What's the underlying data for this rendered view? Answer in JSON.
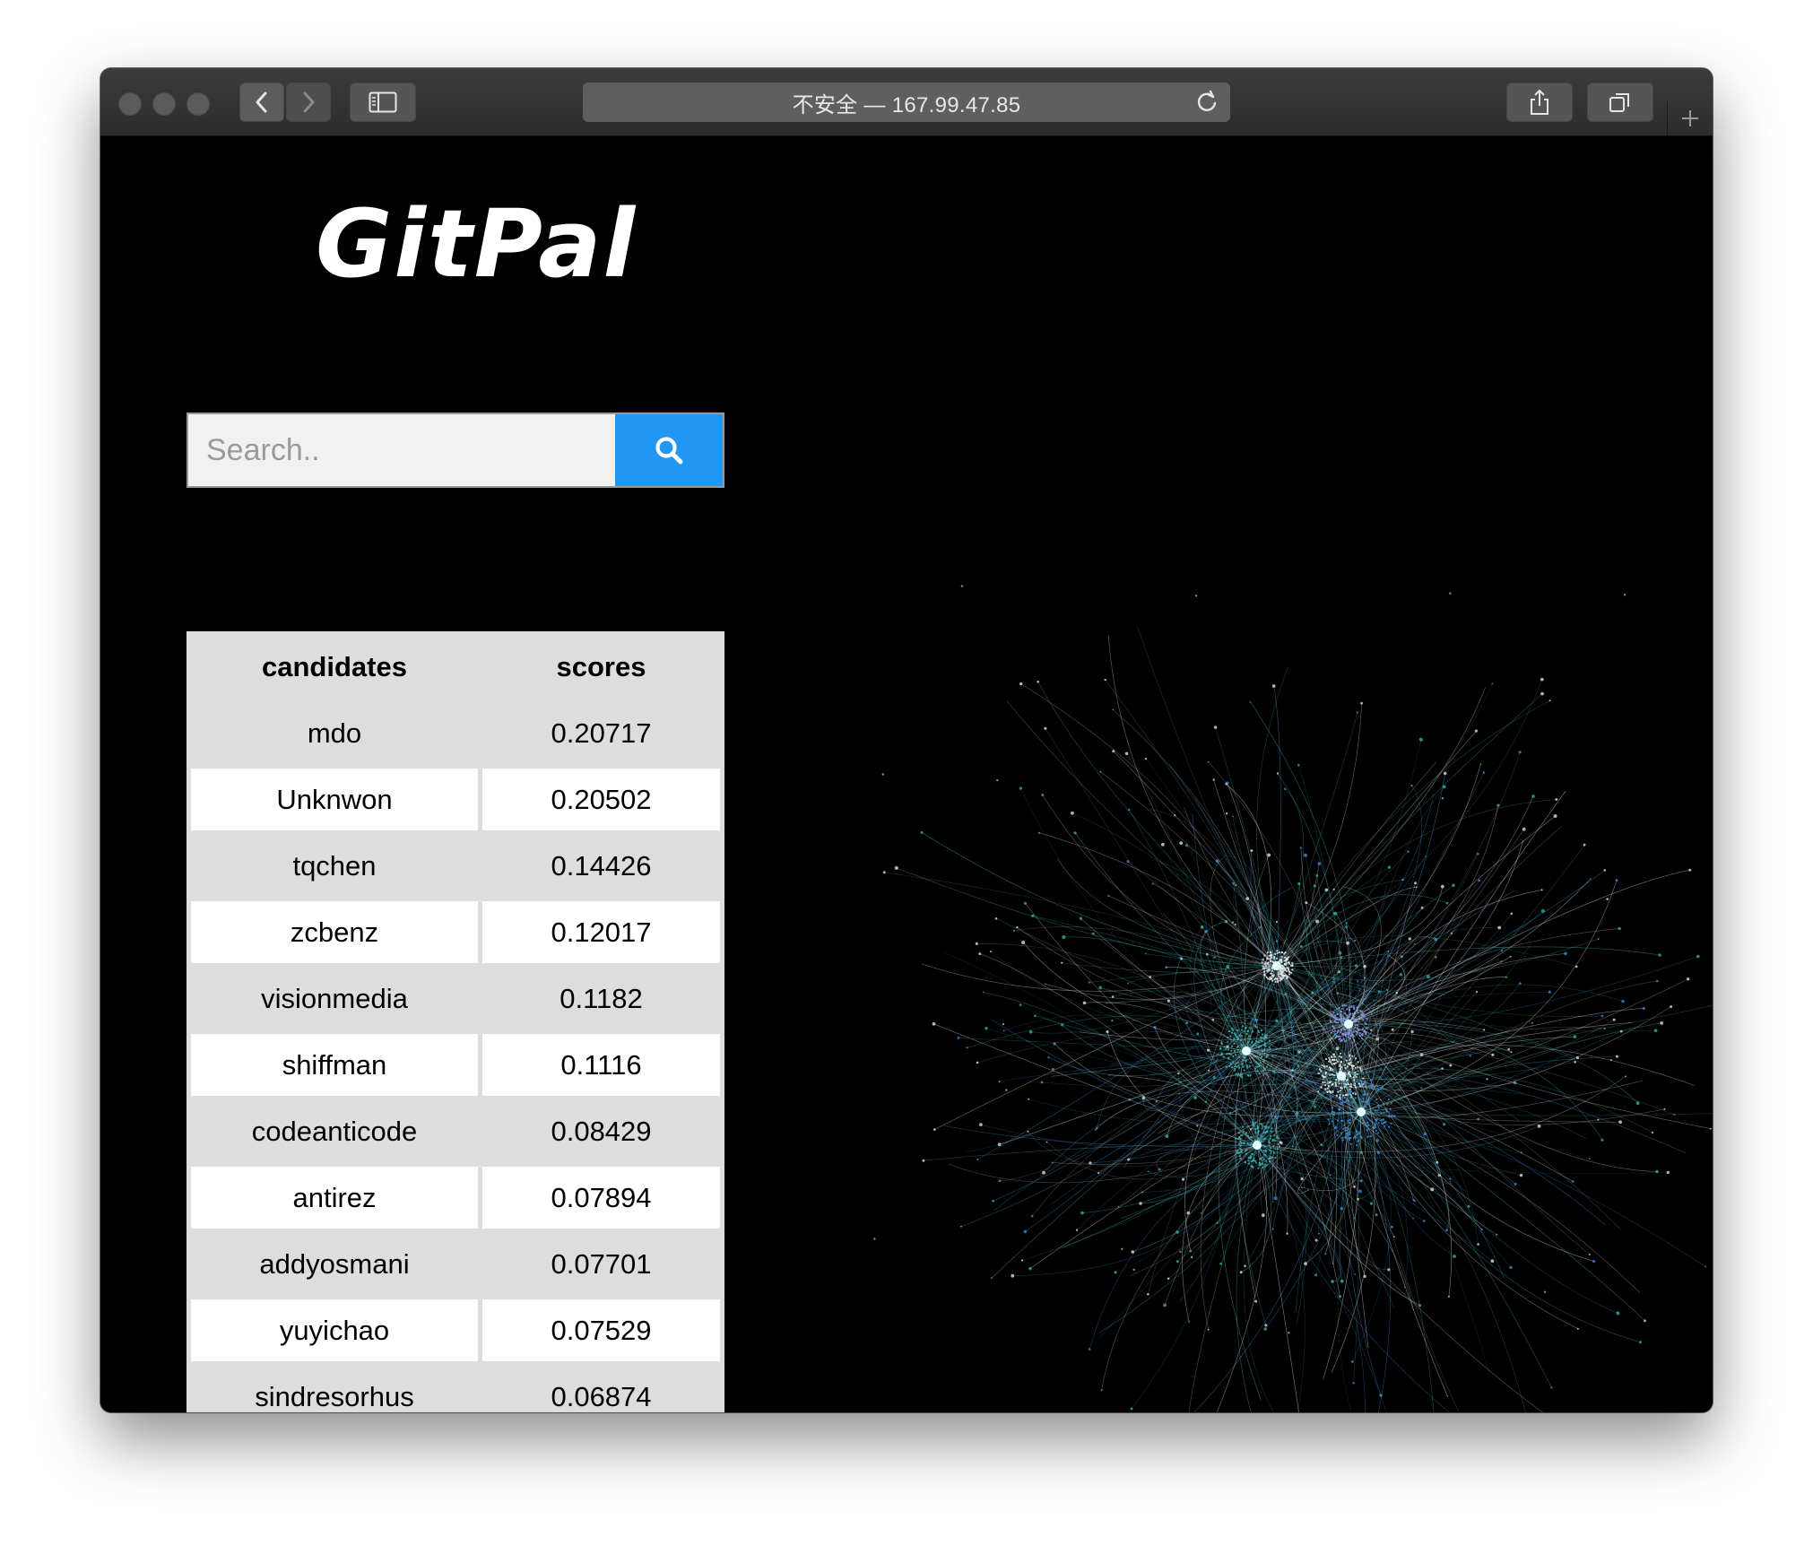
{
  "browser": {
    "address_text": "不安全 — 167.99.47.85"
  },
  "page": {
    "logo": "GitPal",
    "search": {
      "placeholder": "Search.."
    },
    "table": {
      "headers": [
        "candidates",
        "scores"
      ],
      "rows": [
        {
          "candidate": "mdo",
          "score": "0.20717"
        },
        {
          "candidate": "Unknwon",
          "score": "0.20502"
        },
        {
          "candidate": "tqchen",
          "score": "0.14426"
        },
        {
          "candidate": "zcbenz",
          "score": "0.12017"
        },
        {
          "candidate": "visionmedia",
          "score": "0.1182"
        },
        {
          "candidate": "shiffman",
          "score": "0.1116"
        },
        {
          "candidate": "codeanticode",
          "score": "0.08429"
        },
        {
          "candidate": "antirez",
          "score": "0.07894"
        },
        {
          "candidate": "addyosmani",
          "score": "0.07701"
        },
        {
          "candidate": "yuyichao",
          "score": "0.07529"
        },
        {
          "candidate": "sindresorhus",
          "score": "0.06874"
        }
      ]
    }
  },
  "colors": {
    "background": "#000000",
    "search_button": "#2196f3",
    "table_gray": "#dddddd",
    "graph_teal": "#3fb3b0",
    "graph_blue": "#3d8fe0",
    "graph_white": "#e8e8e8"
  }
}
